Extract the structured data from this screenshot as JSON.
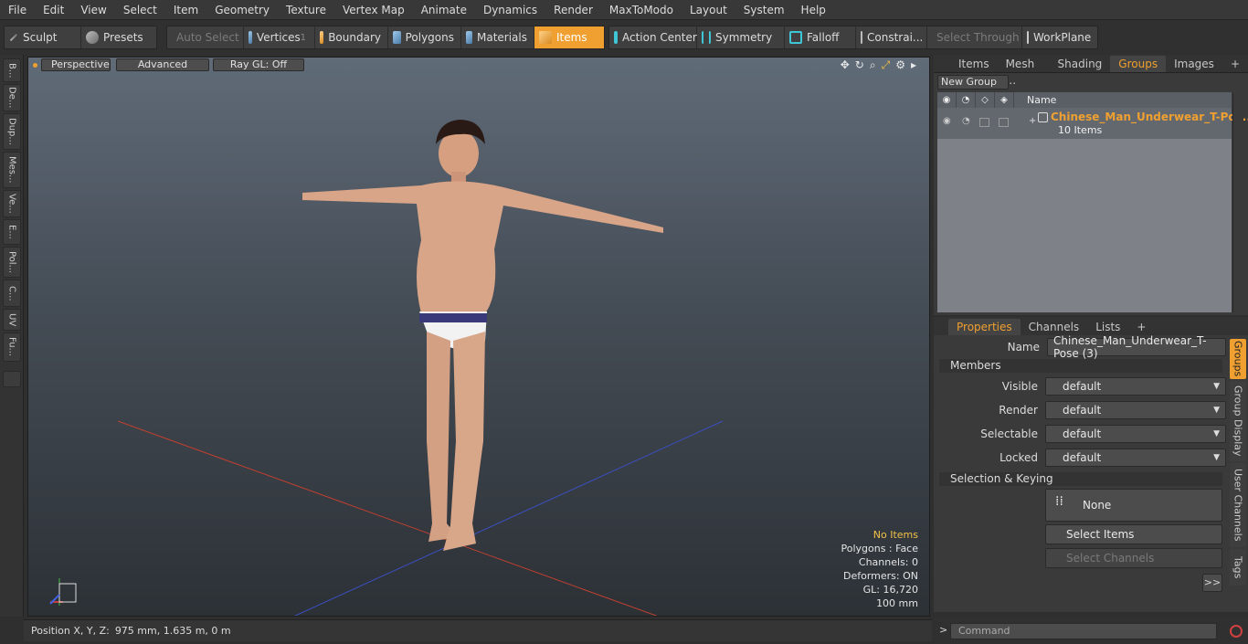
{
  "menubar": [
    "File",
    "Edit",
    "View",
    "Select",
    "Item",
    "Geometry",
    "Texture",
    "Vertex Map",
    "Animate",
    "Dynamics",
    "Render",
    "MaxToModo",
    "Layout",
    "System",
    "Help"
  ],
  "toolbar": {
    "sculpt": "Sculpt",
    "presets": "Presets",
    "auto_select": "Auto Select",
    "vertices": "Vertices",
    "vertices_count": "1",
    "boundary": "Boundary",
    "polygons": "Polygons",
    "materials": "Materials",
    "items": "Items",
    "action_center": "Action Center",
    "symmetry": "Symmetry",
    "falloff": "Falloff",
    "constraints": "Constrai...",
    "select_through": "Select Through",
    "workplane": "WorkPlane"
  },
  "left_tabs": [
    "B...",
    "De...",
    "Dup...",
    "Mes...",
    "Ve...",
    "E...",
    "Pol...",
    "C...",
    "UV",
    "Fu..."
  ],
  "viewport": {
    "view": "Perspective",
    "mode": "Advanced",
    "raygl": "Ray GL: Off",
    "info": {
      "selection": "No Items",
      "polygons": "Polygons : Face",
      "channels": "Channels: 0",
      "deformers": "Deformers: ON",
      "gl": "GL: 16,720",
      "unit": "100 mm"
    }
  },
  "statusbar": {
    "label": "Position X, Y, Z:",
    "value": "975 mm, 1.635 m, 0 m"
  },
  "groups_panel": {
    "tabs": [
      "Items",
      "Mesh ...",
      "Shading",
      "Groups",
      "Images"
    ],
    "active_tab": "Groups",
    "new_group": "New Group",
    "name_header": "Name",
    "row": {
      "name": "Chinese_Man_Underwear_T-Pos...",
      "count": "10 Items"
    }
  },
  "properties": {
    "tabs": [
      "Properties",
      "Channels",
      "Lists"
    ],
    "name_label": "Name",
    "name_value": "Chinese_Man_Underwear_T-Pose (3)",
    "members": "Members",
    "visible_label": "Visible",
    "visible_value": "default",
    "render_label": "Render",
    "render_value": "default",
    "selectable_label": "Selectable",
    "selectable_value": "default",
    "locked_label": "Locked",
    "locked_value": "default",
    "selection_keying": "Selection & Keying",
    "none_btn": "None",
    "select_items": "Select Items",
    "select_channels": "Select Channels",
    "more": ">>",
    "side_tabs": [
      "Groups",
      "Group Display",
      "User Channels",
      "Tags"
    ]
  },
  "command": {
    "placeholder": "Command",
    "prompt": ">"
  }
}
